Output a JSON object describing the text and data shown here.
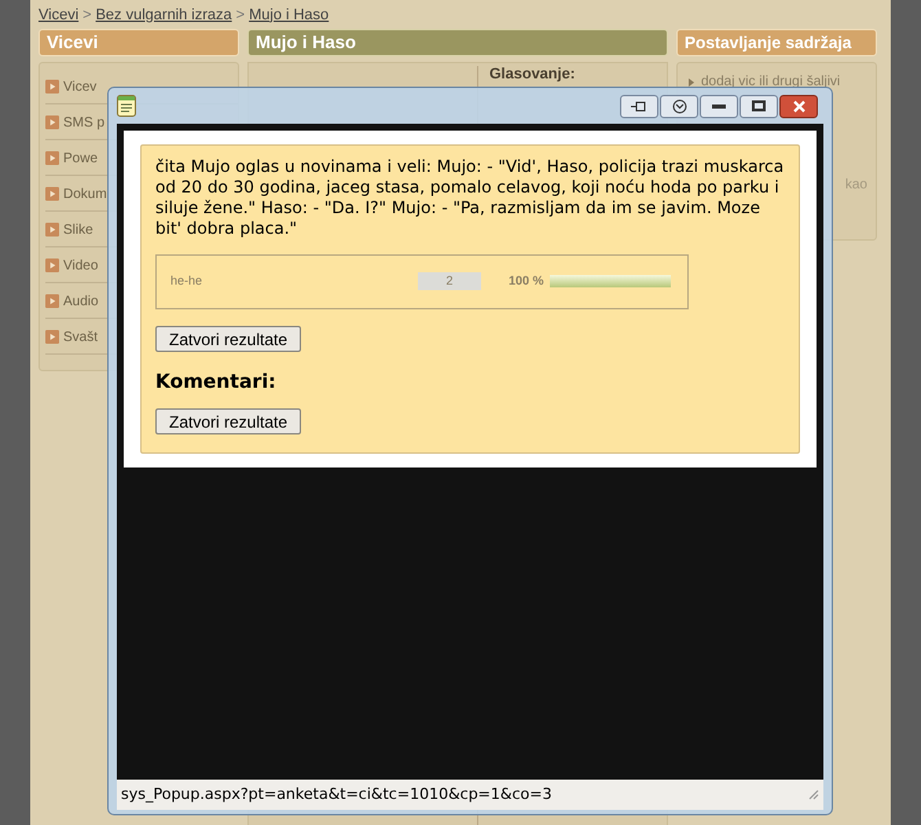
{
  "breadcrumb": {
    "separator": ">",
    "links": [
      "Vicevi",
      "Bez vulgarnih izraza",
      "Mujo i Haso"
    ]
  },
  "left_panel": {
    "title": "Vicevi",
    "items": [
      "Vicev",
      "SMS p",
      "Powe",
      "Dokum",
      "Slike",
      "Video",
      "Audio",
      "Svašt"
    ]
  },
  "middle_panel": {
    "title": "Mujo i Haso",
    "vote_heading": "Glasovanje:"
  },
  "right_panel": {
    "title": "Postavljanje sadržaja",
    "items": [
      "dodaj vic ili drugi šaljivi"
    ],
    "fragment": "kao"
  },
  "popup": {
    "story": "čita Mujo oglas u novinama i veli: Mujo: - \"Vid', Haso, policija trazi muskarca od 20 do 30 godina, jaceg stasa, pomalo celavog, koji noću hoda po parku i siluje žene.\" Haso: - \"Da. I?\" Mujo: - \"Pa, razmisljam da im se javim. Moze bit' dobra placa.\"",
    "poll": [
      {
        "answer": "he-he",
        "votes": "2",
        "percent": "100 %",
        "level": 1
      }
    ],
    "results_button": "Zatvori rezultate",
    "comments_heading": "Komentari:",
    "comments_button": "Zatvori rezultate",
    "status_url": "sys_Popup.aspx?pt=anketa&t=ci&tc=1010&cp=1&co=3"
  }
}
